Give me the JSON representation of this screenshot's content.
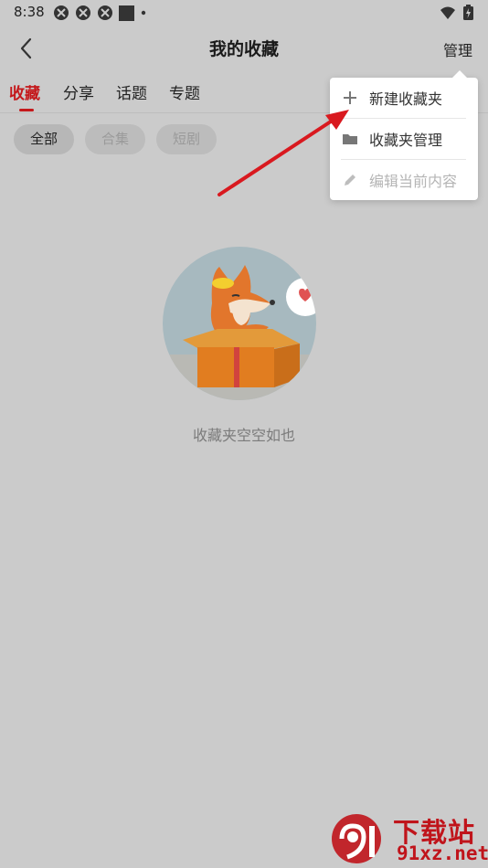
{
  "status_bar": {
    "time": "8:38",
    "icons": [
      "app-icon",
      "app-icon",
      "app-icon",
      "square-icon",
      "dot-icon"
    ],
    "right_icons": [
      "wifi-icon",
      "battery-icon"
    ]
  },
  "header": {
    "back_icon": "chevron-left-icon",
    "title": "我的收藏",
    "manage_label": "管理"
  },
  "tabs": [
    {
      "label": "收藏",
      "active": true
    },
    {
      "label": "分享",
      "active": false
    },
    {
      "label": "话题",
      "active": false
    },
    {
      "label": "专题",
      "active": false
    }
  ],
  "filters": [
    {
      "label": "全部",
      "active": true
    },
    {
      "label": "合集",
      "active": false
    },
    {
      "label": "短剧",
      "active": false
    }
  ],
  "empty_state": {
    "illustration": "fox-in-box-illustration",
    "message": "收藏夹空空如也"
  },
  "dropdown_menu": {
    "items": [
      {
        "label": "新建收藏夹",
        "icon": "plus-icon",
        "enabled": true
      },
      {
        "label": "收藏夹管理",
        "icon": "folder-icon",
        "enabled": true
      },
      {
        "label": "编辑当前内容",
        "icon": "pencil-icon",
        "enabled": false
      }
    ]
  },
  "annotation": {
    "type": "red-arrow",
    "color": "#d9191f"
  },
  "watermark": {
    "top": "下载站",
    "bottom": "91xz.net",
    "logo": "91-logo"
  },
  "colors": {
    "accent": "#c4181b",
    "overlay_bg": "#cbcbcb",
    "menu_bg": "#ffffff"
  }
}
